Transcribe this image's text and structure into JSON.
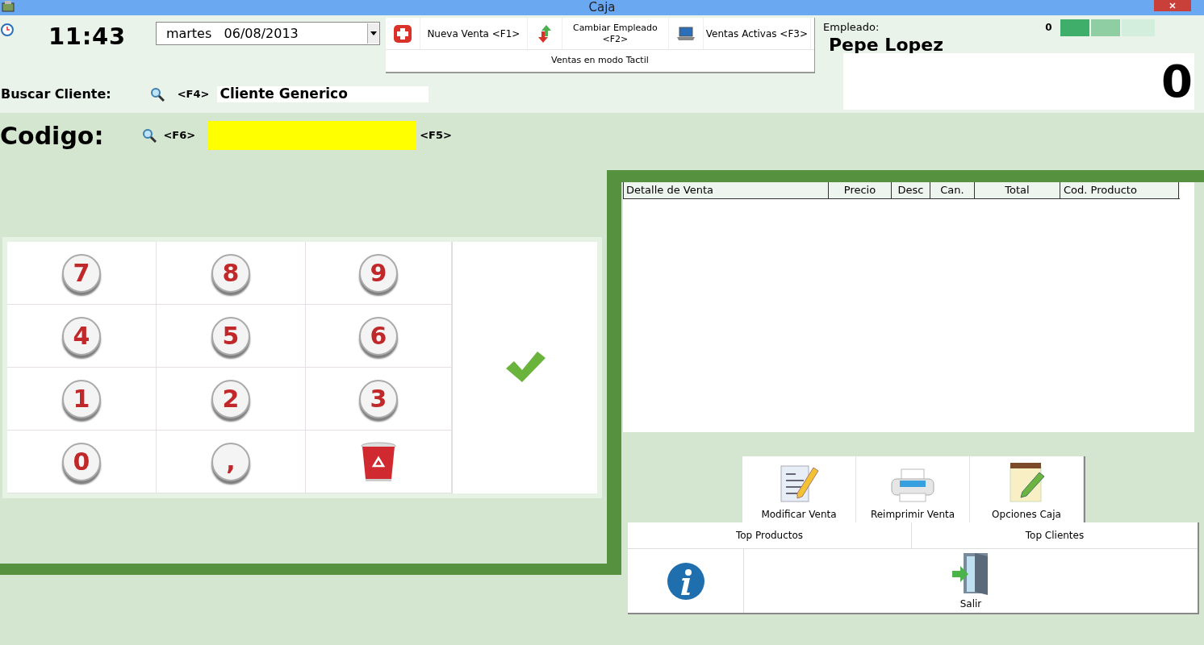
{
  "window": {
    "title": "Caja"
  },
  "clock": {
    "time": "11:43"
  },
  "date_picker": {
    "day": "martes",
    "date": "06/08/2013"
  },
  "toolbar": {
    "buttons": [
      {
        "kind": "new",
        "label": "Nueva Venta <F1>"
      },
      {
        "kind": "switch",
        "label": "Cambiar Empleado <F2>"
      },
      {
        "kind": "active",
        "label": "Ventas Activas <F3>"
      }
    ],
    "touch_mode": "Ventas en modo Tactil"
  },
  "employee": {
    "label": "Empleado:",
    "count": "0",
    "name": "Pepe Lopez",
    "total": "0"
  },
  "customer": {
    "label": "Buscar Cliente:",
    "shortcut": "<F4>",
    "value": "Cliente Generico"
  },
  "code": {
    "label": "Codigo:",
    "search_shortcut": "<F6>",
    "enter_shortcut": "<F5>"
  },
  "keypad": [
    {
      "kind": "digit",
      "label": "7"
    },
    {
      "kind": "digit",
      "label": "8"
    },
    {
      "kind": "digit",
      "label": "9"
    },
    {
      "kind": "digit",
      "label": "4"
    },
    {
      "kind": "digit",
      "label": "5"
    },
    {
      "kind": "digit",
      "label": "6"
    },
    {
      "kind": "digit",
      "label": "1"
    },
    {
      "kind": "digit",
      "label": "2"
    },
    {
      "kind": "digit",
      "label": "3"
    },
    {
      "kind": "digit",
      "label": "0"
    },
    {
      "kind": "digit",
      "label": ","
    },
    {
      "kind": "delete"
    },
    {
      "kind": "enter"
    }
  ],
  "table": {
    "columns": [
      "Detalle de Venta",
      "Precio",
      "Desc",
      "Can.",
      "Total",
      "Cod. Producto"
    ]
  },
  "actions": [
    {
      "kind": "edit",
      "label": "Modificar Venta"
    },
    {
      "kind": "print",
      "label": "Reimprimir Venta"
    },
    {
      "kind": "options",
      "label": "Opciones Caja"
    }
  ],
  "reports": [
    "Top Productos",
    "Top Clientes"
  ],
  "exit": {
    "label": "Salir"
  }
}
